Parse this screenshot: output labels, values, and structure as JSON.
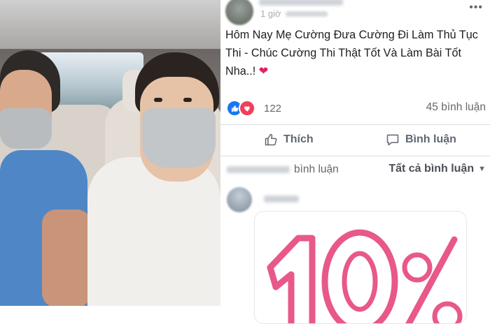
{
  "post": {
    "time": "1 giờ",
    "text": "Hôm Nay Mẹ Cường Đưa Cường Đi Làm Thủ Tục Thi - Chúc Cường Thi Thật Tốt Và Làm Bài Tốt Nha..!",
    "emoji": "❤",
    "more_icon": "•••"
  },
  "stats": {
    "reaction_count": "122",
    "comment_count": "45 bình luận"
  },
  "actions": {
    "like_label": "Thích",
    "comment_label": "Bình luận"
  },
  "comments_bar": {
    "view_more_label": "bình luận",
    "filter_label": "Tất cả bình luận",
    "filter_caret": "▼"
  },
  "icons": {
    "more": "more-horizontal-icon",
    "like": "thumbs-up-icon",
    "comment": "comment-bubble-icon",
    "reaction_like": "like-reaction-icon",
    "reaction_love": "love-reaction-icon"
  },
  "colors": {
    "accent": "#1877f2",
    "love": "#f33e58",
    "text": "#1c1e21",
    "muted": "#65676b",
    "graphic_pink": "#e8588a"
  },
  "comment_graphic": {
    "digits": "10",
    "symbol": "%"
  }
}
